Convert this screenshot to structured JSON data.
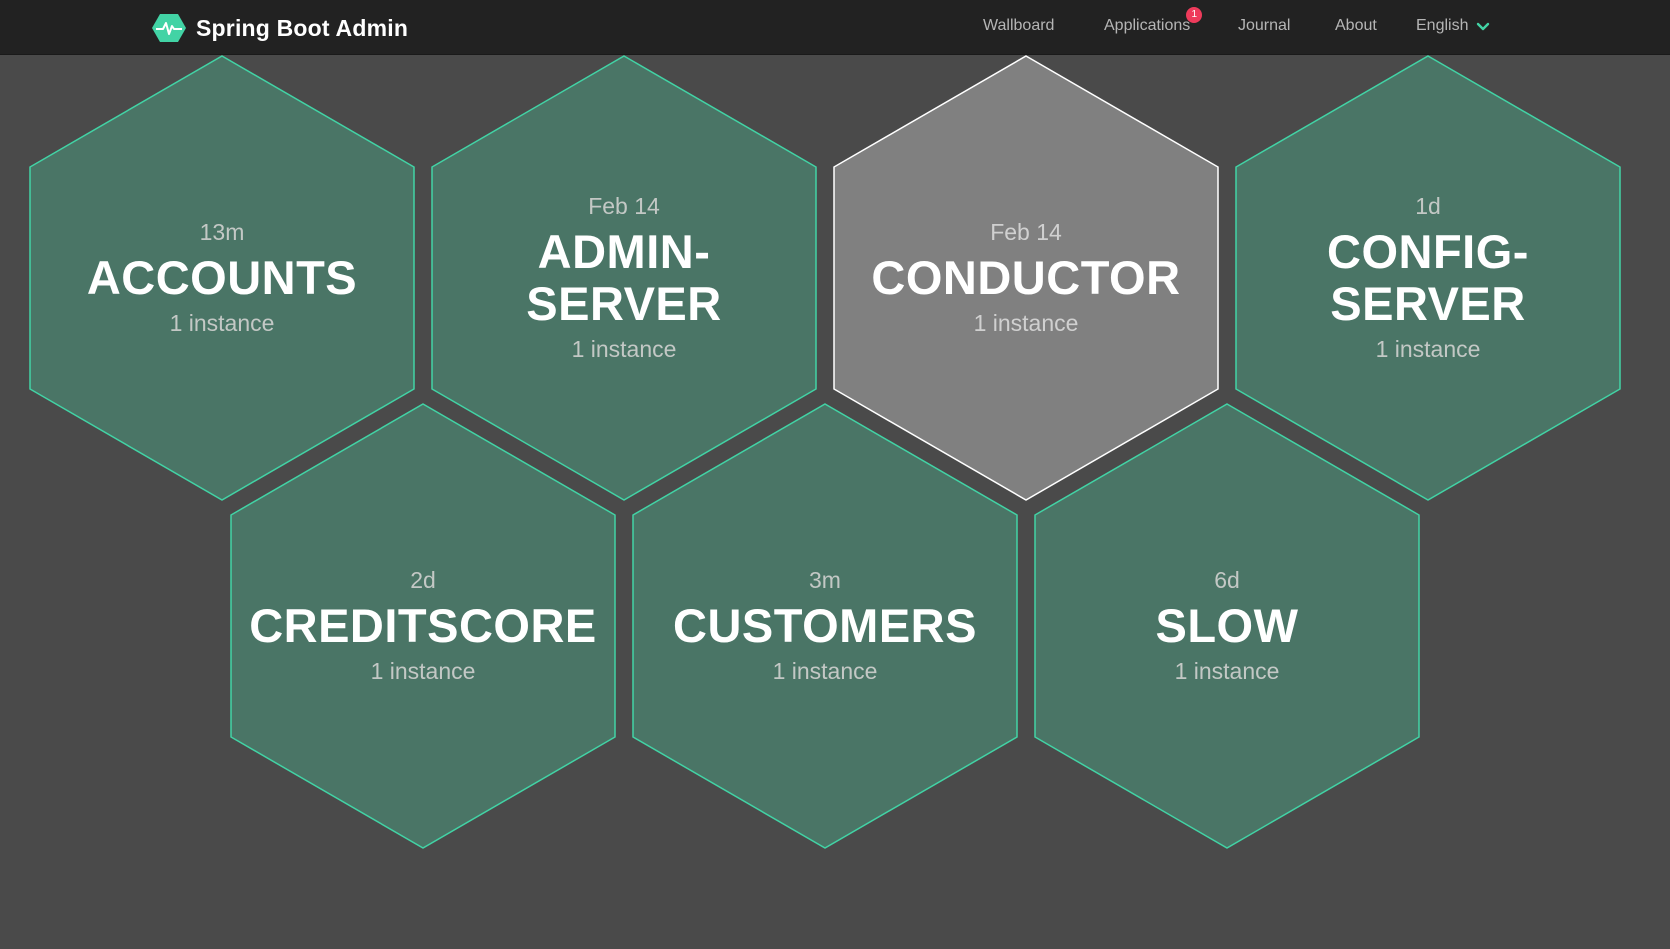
{
  "navbar": {
    "brand": "Spring Boot Admin",
    "items": {
      "wallboard": "Wallboard",
      "applications": "Applications",
      "applications_badge": "1",
      "journal": "Journal",
      "about": "About",
      "language": "English"
    }
  },
  "colors": {
    "navbar_bg": "#222222",
    "page_bg": "#4a4a4a",
    "up_fill": "#4a7566",
    "up_border": "#42d3a5",
    "offline_fill": "#808080",
    "offline_border": "#ffffff",
    "badge": "#ee3b5b"
  },
  "applications": [
    {
      "name_lines": [
        "ACCOUNTS"
      ],
      "since": "13m",
      "instances": "1 instance",
      "status": "UP"
    },
    {
      "name_lines": [
        "ADMIN-",
        "SERVER"
      ],
      "since": "Feb 14",
      "instances": "1 instance",
      "status": "UP"
    },
    {
      "name_lines": [
        "CONDUCTOR"
      ],
      "since": "Feb 14",
      "instances": "1 instance",
      "status": "OFFLINE"
    },
    {
      "name_lines": [
        "CONFIG-",
        "SERVER"
      ],
      "since": "1d",
      "instances": "1 instance",
      "status": "UP"
    },
    {
      "name_lines": [
        "CREDITSCORE"
      ],
      "since": "2d",
      "instances": "1 instance",
      "status": "UP"
    },
    {
      "name_lines": [
        "CUSTOMERS"
      ],
      "since": "3m",
      "instances": "1 instance",
      "status": "UP"
    },
    {
      "name_lines": [
        "SLOW"
      ],
      "since": "6d",
      "instances": "1 instance",
      "status": "UP"
    }
  ]
}
